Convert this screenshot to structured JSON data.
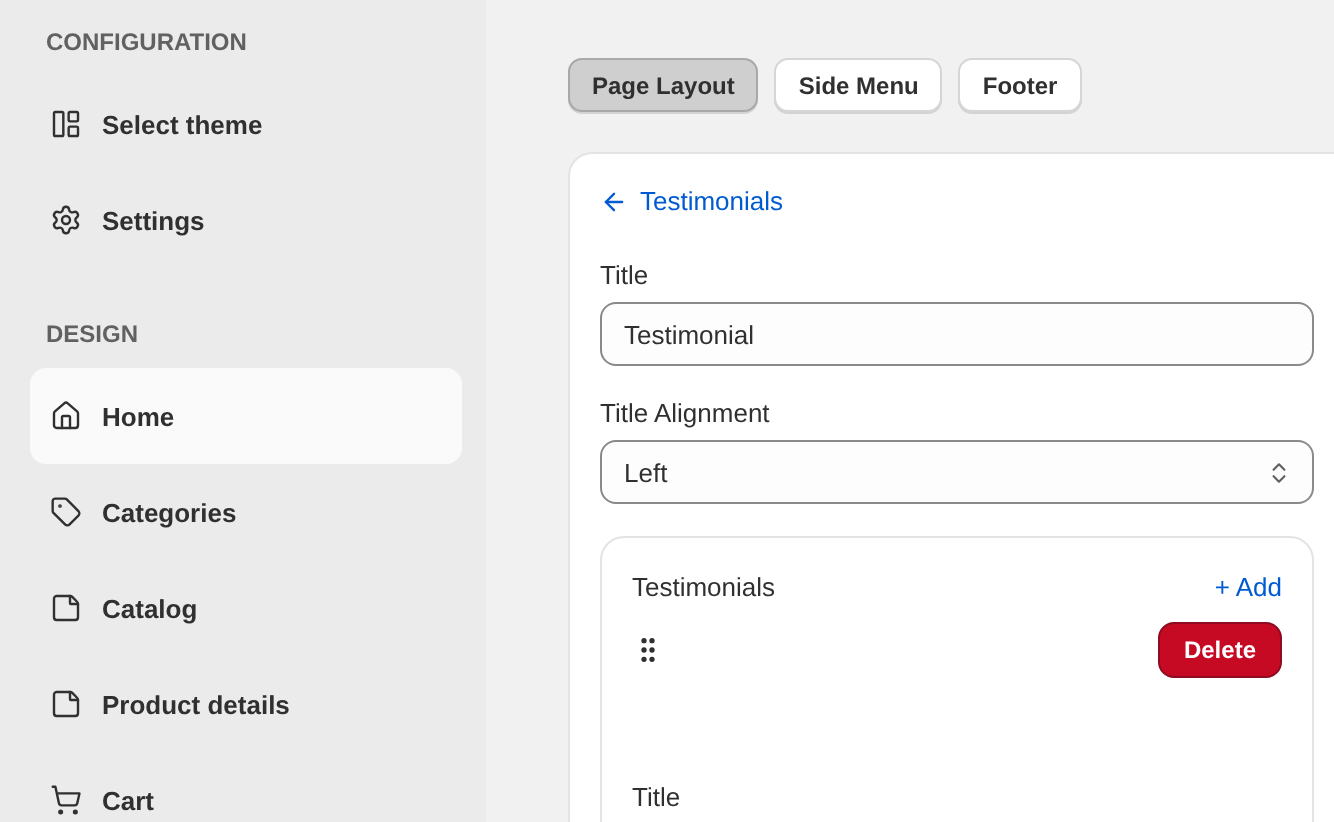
{
  "sidebar": {
    "sections": [
      {
        "heading": "CONFIGURATION",
        "items": [
          {
            "label": "Select theme",
            "kind": "theme",
            "selected": false
          },
          {
            "label": "Settings",
            "kind": "gear",
            "selected": false
          }
        ]
      },
      {
        "heading": "DESIGN",
        "items": [
          {
            "label": "Home",
            "kind": "home",
            "selected": true
          },
          {
            "label": "Categories",
            "kind": "tag",
            "selected": false
          },
          {
            "label": "Catalog",
            "kind": "note",
            "selected": false
          },
          {
            "label": "Product details",
            "kind": "note",
            "selected": false
          },
          {
            "label": "Cart",
            "kind": "cart",
            "selected": false
          }
        ]
      }
    ]
  },
  "tabs": [
    {
      "label": "Page Layout",
      "selected": true
    },
    {
      "label": "Side Menu",
      "selected": false
    },
    {
      "label": "Footer",
      "selected": false
    }
  ],
  "editor": {
    "back_link": "Testimonials",
    "fields": [
      {
        "kind": "text",
        "label": "Title",
        "value": "Testimonial"
      },
      {
        "kind": "select",
        "label": "Title Alignment",
        "value": "Left"
      }
    ],
    "list": {
      "title": "Testimonials",
      "add_label": "+ Add",
      "items": [
        {
          "delete_label": "Delete",
          "field_label": "Title"
        }
      ]
    }
  }
}
